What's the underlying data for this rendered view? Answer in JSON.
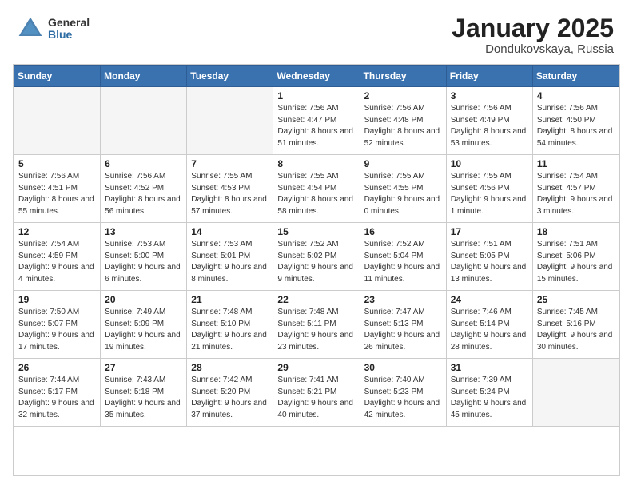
{
  "header": {
    "logo_general": "General",
    "logo_blue": "Blue",
    "month_title": "January 2025",
    "location": "Dondukovskaya, Russia"
  },
  "weekdays": [
    "Sunday",
    "Monday",
    "Tuesday",
    "Wednesday",
    "Thursday",
    "Friday",
    "Saturday"
  ],
  "weeks": [
    {
      "row_class": "row-odd",
      "days": [
        {
          "num": "",
          "info": "",
          "empty": true
        },
        {
          "num": "",
          "info": "",
          "empty": true
        },
        {
          "num": "",
          "info": "",
          "empty": true
        },
        {
          "num": "1",
          "info": "Sunrise: 7:56 AM\nSunset: 4:47 PM\nDaylight: 8 hours and 51 minutes."
        },
        {
          "num": "2",
          "info": "Sunrise: 7:56 AM\nSunset: 4:48 PM\nDaylight: 8 hours and 52 minutes."
        },
        {
          "num": "3",
          "info": "Sunrise: 7:56 AM\nSunset: 4:49 PM\nDaylight: 8 hours and 53 minutes."
        },
        {
          "num": "4",
          "info": "Sunrise: 7:56 AM\nSunset: 4:50 PM\nDaylight: 8 hours and 54 minutes."
        }
      ]
    },
    {
      "row_class": "row-even",
      "days": [
        {
          "num": "5",
          "info": "Sunrise: 7:56 AM\nSunset: 4:51 PM\nDaylight: 8 hours and 55 minutes."
        },
        {
          "num": "6",
          "info": "Sunrise: 7:56 AM\nSunset: 4:52 PM\nDaylight: 8 hours and 56 minutes."
        },
        {
          "num": "7",
          "info": "Sunrise: 7:55 AM\nSunset: 4:53 PM\nDaylight: 8 hours and 57 minutes."
        },
        {
          "num": "8",
          "info": "Sunrise: 7:55 AM\nSunset: 4:54 PM\nDaylight: 8 hours and 58 minutes."
        },
        {
          "num": "9",
          "info": "Sunrise: 7:55 AM\nSunset: 4:55 PM\nDaylight: 9 hours and 0 minutes."
        },
        {
          "num": "10",
          "info": "Sunrise: 7:55 AM\nSunset: 4:56 PM\nDaylight: 9 hours and 1 minute."
        },
        {
          "num": "11",
          "info": "Sunrise: 7:54 AM\nSunset: 4:57 PM\nDaylight: 9 hours and 3 minutes."
        }
      ]
    },
    {
      "row_class": "row-odd",
      "days": [
        {
          "num": "12",
          "info": "Sunrise: 7:54 AM\nSunset: 4:59 PM\nDaylight: 9 hours and 4 minutes."
        },
        {
          "num": "13",
          "info": "Sunrise: 7:53 AM\nSunset: 5:00 PM\nDaylight: 9 hours and 6 minutes."
        },
        {
          "num": "14",
          "info": "Sunrise: 7:53 AM\nSunset: 5:01 PM\nDaylight: 9 hours and 8 minutes."
        },
        {
          "num": "15",
          "info": "Sunrise: 7:52 AM\nSunset: 5:02 PM\nDaylight: 9 hours and 9 minutes."
        },
        {
          "num": "16",
          "info": "Sunrise: 7:52 AM\nSunset: 5:04 PM\nDaylight: 9 hours and 11 minutes."
        },
        {
          "num": "17",
          "info": "Sunrise: 7:51 AM\nSunset: 5:05 PM\nDaylight: 9 hours and 13 minutes."
        },
        {
          "num": "18",
          "info": "Sunrise: 7:51 AM\nSunset: 5:06 PM\nDaylight: 9 hours and 15 minutes."
        }
      ]
    },
    {
      "row_class": "row-even",
      "days": [
        {
          "num": "19",
          "info": "Sunrise: 7:50 AM\nSunset: 5:07 PM\nDaylight: 9 hours and 17 minutes."
        },
        {
          "num": "20",
          "info": "Sunrise: 7:49 AM\nSunset: 5:09 PM\nDaylight: 9 hours and 19 minutes."
        },
        {
          "num": "21",
          "info": "Sunrise: 7:48 AM\nSunset: 5:10 PM\nDaylight: 9 hours and 21 minutes."
        },
        {
          "num": "22",
          "info": "Sunrise: 7:48 AM\nSunset: 5:11 PM\nDaylight: 9 hours and 23 minutes."
        },
        {
          "num": "23",
          "info": "Sunrise: 7:47 AM\nSunset: 5:13 PM\nDaylight: 9 hours and 26 minutes."
        },
        {
          "num": "24",
          "info": "Sunrise: 7:46 AM\nSunset: 5:14 PM\nDaylight: 9 hours and 28 minutes."
        },
        {
          "num": "25",
          "info": "Sunrise: 7:45 AM\nSunset: 5:16 PM\nDaylight: 9 hours and 30 minutes."
        }
      ]
    },
    {
      "row_class": "row-odd",
      "days": [
        {
          "num": "26",
          "info": "Sunrise: 7:44 AM\nSunset: 5:17 PM\nDaylight: 9 hours and 32 minutes."
        },
        {
          "num": "27",
          "info": "Sunrise: 7:43 AM\nSunset: 5:18 PM\nDaylight: 9 hours and 35 minutes."
        },
        {
          "num": "28",
          "info": "Sunrise: 7:42 AM\nSunset: 5:20 PM\nDaylight: 9 hours and 37 minutes."
        },
        {
          "num": "29",
          "info": "Sunrise: 7:41 AM\nSunset: 5:21 PM\nDaylight: 9 hours and 40 minutes."
        },
        {
          "num": "30",
          "info": "Sunrise: 7:40 AM\nSunset: 5:23 PM\nDaylight: 9 hours and 42 minutes."
        },
        {
          "num": "31",
          "info": "Sunrise: 7:39 AM\nSunset: 5:24 PM\nDaylight: 9 hours and 45 minutes."
        },
        {
          "num": "",
          "info": "",
          "empty": true
        }
      ]
    }
  ]
}
